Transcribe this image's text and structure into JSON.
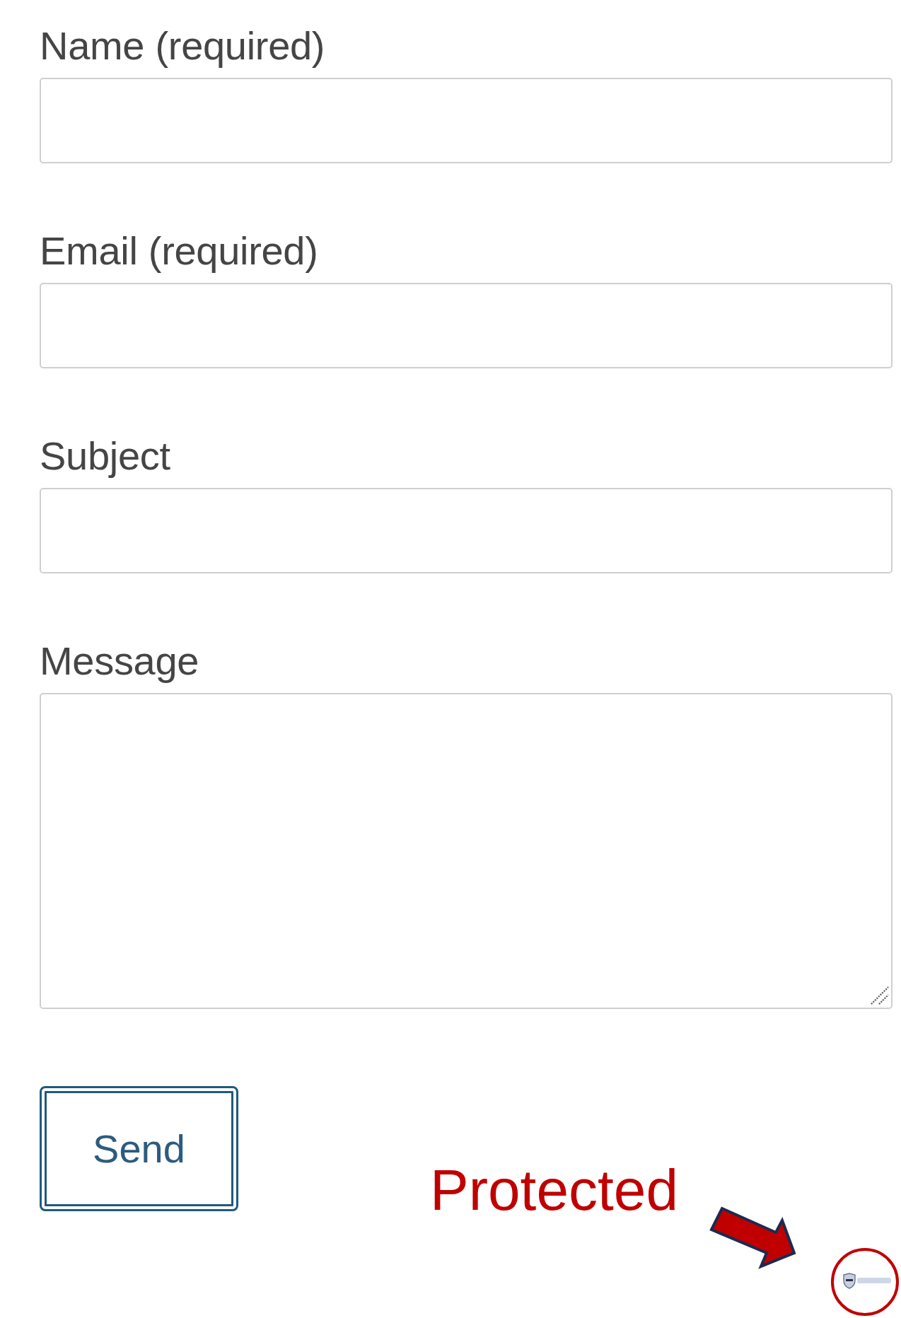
{
  "form": {
    "fields": [
      {
        "kind": "input",
        "label": "Name (required)"
      },
      {
        "kind": "input",
        "label": "Email (required)"
      },
      {
        "kind": "input",
        "label": "Subject"
      },
      {
        "kind": "textarea",
        "label": "Message"
      }
    ],
    "submit_button": "Send"
  },
  "annotation": {
    "text": "Protected"
  }
}
